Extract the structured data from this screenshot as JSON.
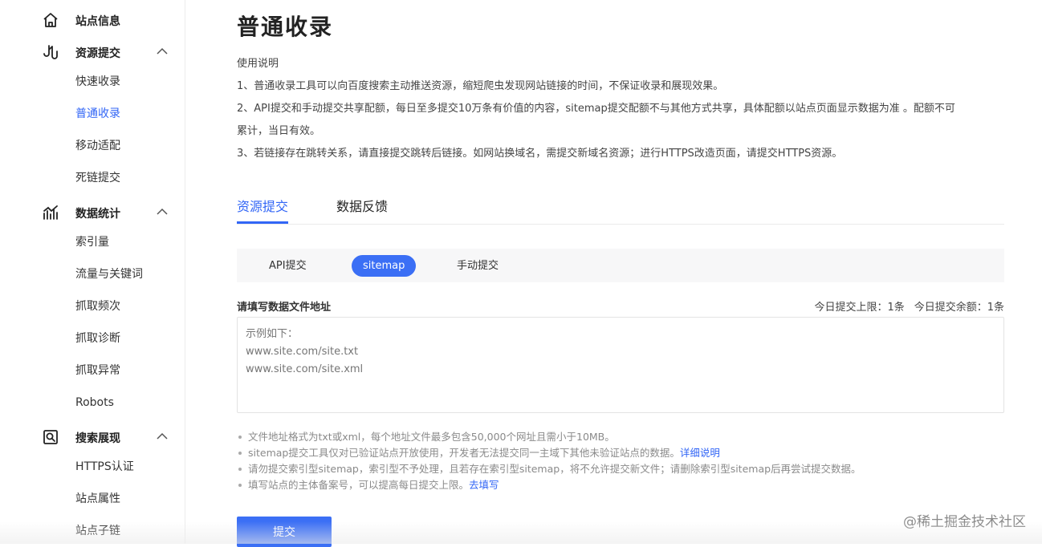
{
  "sidebar": {
    "groups": [
      {
        "label": "站点信息",
        "icon": "home-icon"
      },
      {
        "label": "资源提交",
        "icon": "submit-icon",
        "items": [
          "快速收录",
          "普通收录",
          "移动适配",
          "死链提交"
        ]
      },
      {
        "label": "数据统计",
        "icon": "stats-icon",
        "items": [
          "索引量",
          "流量与关键词",
          "抓取频次",
          "抓取诊断",
          "抓取异常",
          "Robots"
        ]
      },
      {
        "label": "搜索展现",
        "icon": "search-display-icon",
        "items": [
          "HTTPS认证",
          "站点属性",
          "站点子链"
        ]
      }
    ],
    "active_item": "普通收录"
  },
  "main": {
    "title": "普通收录",
    "instructions": {
      "heading": "使用说明",
      "lines": [
        "1、普通收录工具可以向百度搜索主动推送资源，缩短爬虫发现网站链接的时间，不保证收录和展现效果。",
        "2、API提交和手动提交共享配额，每日至多提交10万条有价值的内容，sitemap提交配额不与其他方式共享，具体配额以站点页面显示数据为准 。配额不可",
        "累计，当日有效。",
        "3、若链接存在跳转关系，请直接提交跳转后链接。如网站换域名，需提交新域名资源；进行HTTPS改造页面，请提交HTTPS资源。"
      ]
    },
    "tabs": [
      {
        "label": "资源提交",
        "active": true
      },
      {
        "label": "数据反馈",
        "active": false
      }
    ],
    "subtabs": [
      {
        "label": "API提交",
        "active": false
      },
      {
        "label": "sitemap",
        "active": true
      },
      {
        "label": "手动提交",
        "active": false
      }
    ],
    "form": {
      "label": "请填写数据文件地址",
      "quota_limit": "今日提交上限：1条",
      "quota_remaining": "今日提交余额：1条",
      "placeholder": "示例如下：\nwww.site.com/site.txt\nwww.site.com/site.xml",
      "value": ""
    },
    "notes": [
      {
        "text": "文件地址格式为txt或xml，每个地址文件最多包含50,000个网址且需小于10MB。"
      },
      {
        "text": "sitemap提交工具仅对已验证站点开放使用，开发者无法提交同一主域下其他未验证站点的数据。",
        "link": "详细说明"
      },
      {
        "text": "请勿提交索引型sitemap，索引型不予处理，且若存在索引型sitemap，将不允许提交新文件；请删除索引型sitemap后再尝试提交数据。"
      },
      {
        "text": "填写站点的主体备案号，可以提高每日提交上限。",
        "link": "去填写"
      }
    ],
    "submit_label": "提交"
  },
  "watermark": "@稀土掘金技术社区",
  "colors": {
    "accent": "#3266f6",
    "button": "#3b6ff5"
  }
}
